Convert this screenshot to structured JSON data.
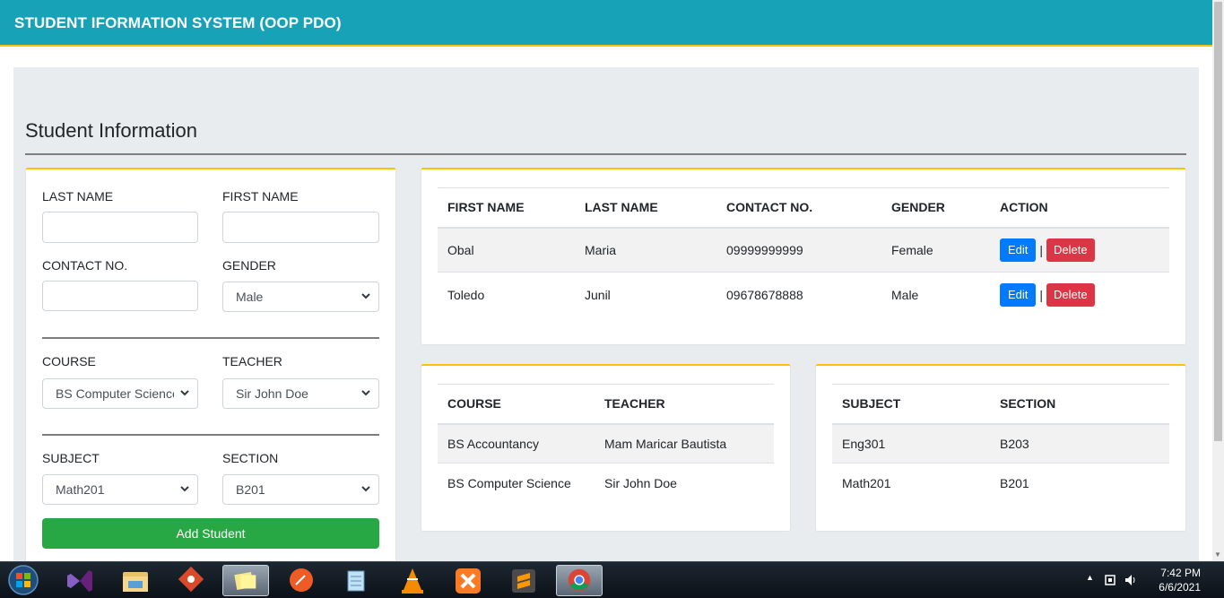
{
  "app": {
    "title": "STUDENT IFORMATION SYSTEM (OOP PDO)"
  },
  "page": {
    "section_title": "Student Information"
  },
  "form": {
    "last_name_label": "LAST NAME",
    "first_name_label": "FIRST NAME",
    "contact_label": "CONTACT NO.",
    "gender_label": "GENDER",
    "gender_value": "Male",
    "course_label": "COURSE",
    "course_value": "BS Computer Science",
    "teacher_label": "TEACHER",
    "teacher_value": "Sir John Doe",
    "subject_label": "SUBJECT",
    "subject_value": "Math201",
    "section_label": "SECTION",
    "section_value": "B201",
    "add_button": "Add Student"
  },
  "students_table": {
    "headers": [
      "FIRST NAME",
      "LAST NAME",
      "CONTACT NO.",
      "GENDER",
      "ACTION"
    ],
    "rows": [
      {
        "first": "Obal",
        "last": "Maria",
        "contact": "09999999999",
        "gender": "Female"
      },
      {
        "first": "Toledo",
        "last": "Junil",
        "contact": "09678678888",
        "gender": "Male"
      }
    ],
    "edit_label": "Edit",
    "delete_label": "Delete",
    "separator": "|"
  },
  "course_table": {
    "headers": [
      "COURSE",
      "TEACHER"
    ],
    "rows": [
      {
        "course": "BS Accountancy",
        "teacher": "Mam Maricar Bautista"
      },
      {
        "course": "BS Computer Science",
        "teacher": "Sir John Doe"
      }
    ]
  },
  "subject_table": {
    "headers": [
      "SUBJECT",
      "SECTION"
    ],
    "rows": [
      {
        "subject": "Eng301",
        "section": "B203"
      },
      {
        "subject": "Math201",
        "section": "B201"
      }
    ]
  },
  "taskbar": {
    "time": "7:42 PM",
    "date": "6/6/2021",
    "icons": [
      "windows-start-icon",
      "visual-studio-icon",
      "file-explorer-icon",
      "git-icon",
      "sticky-notes-icon",
      "postman-icon",
      "notepad-icon",
      "vlc-icon",
      "xampp-icon",
      "sublime-text-icon",
      "chrome-icon"
    ]
  },
  "colors": {
    "navbar": "#17a2b8",
    "accent_border": "#ffc107",
    "add_button": "#28a745",
    "edit_button": "#007bff",
    "delete_button": "#dc3545",
    "page_background": "#e9ecef"
  }
}
